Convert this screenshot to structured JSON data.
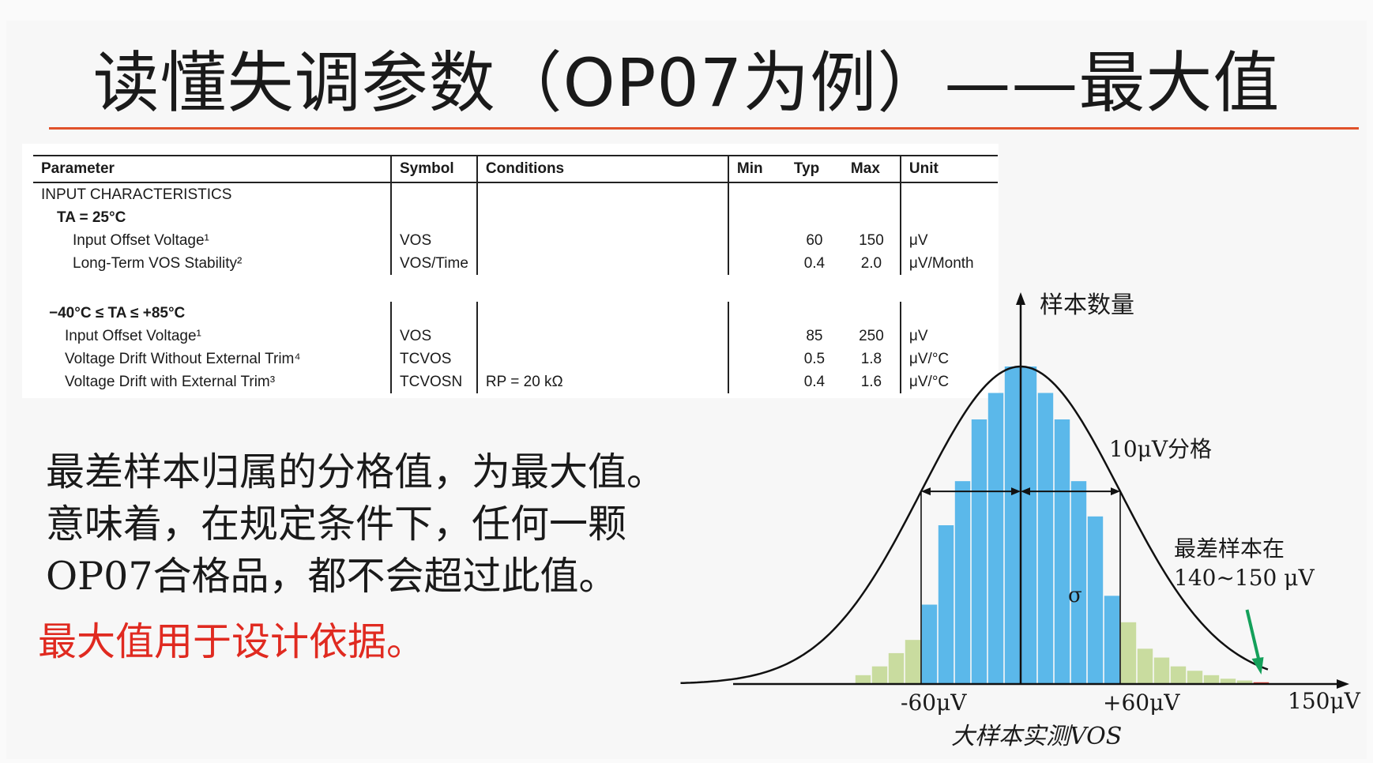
{
  "title": "读懂失调参数（OP07为例）——最大值",
  "spec_table": {
    "headers": [
      "Parameter",
      "Symbol",
      "Conditions",
      "Min",
      "Typ",
      "Max",
      "Unit"
    ],
    "section1": {
      "heading": "INPUT CHARACTERISTICS",
      "condition": "TA = 25°C",
      "rows": [
        {
          "parameter": "Input Offset Voltage¹",
          "symbol": "VOS",
          "conditions": "",
          "min": "",
          "typ": "60",
          "max": "150",
          "unit": "μV"
        },
        {
          "parameter": "Long-Term VOS Stability²",
          "symbol": "VOS/Time",
          "conditions": "",
          "min": "",
          "typ": "0.4",
          "max": "2.0",
          "unit": "μV/Month"
        }
      ]
    },
    "section2": {
      "condition": "−40°C ≤ TA ≤ +85°C",
      "rows": [
        {
          "parameter": "Input Offset Voltage¹",
          "symbol": "VOS",
          "conditions": "",
          "min": "",
          "typ": "85",
          "max": "250",
          "unit": "μV"
        },
        {
          "parameter": "Voltage Drift Without External Trim⁴",
          "symbol": "TCVOS",
          "conditions": "",
          "min": "",
          "typ": "0.5",
          "max": "1.8",
          "unit": "μV/°C"
        },
        {
          "parameter": "Voltage Drift with External Trim³",
          "symbol": "TCVOSN",
          "conditions": "RP = 20 kΩ",
          "min": "",
          "typ": "0.4",
          "max": "1.6",
          "unit": "μV/°C"
        }
      ]
    }
  },
  "paragraph": [
    "最差样本归属的分格值，为最大值。",
    "意味着，在规定条件下，任何一颗",
    "OP07合格品，都不会超过此值。"
  ],
  "highlight": "最大值用于设计依据。",
  "chart_data": {
    "type": "bar",
    "y_axis_label": "样本数量",
    "x_axis_label": "大样本实测VOS",
    "bin_width_label": "10μV分格",
    "sigma_label": "σ",
    "worst_sample_annotation": [
      "最差样本在",
      "140~150 μV"
    ],
    "tick_labels": [
      "-60μV",
      "+60μV",
      "150μV"
    ],
    "bin_centers": [
      -95,
      -85,
      -75,
      -65,
      -55,
      -45,
      -35,
      -25,
      -15,
      -5,
      5,
      15,
      25,
      35,
      45,
      55,
      65,
      75,
      85,
      95,
      105,
      115,
      125,
      135,
      145
    ],
    "counts": [
      1,
      2,
      3.5,
      5,
      9,
      18,
      23,
      30,
      33,
      36,
      36,
      33,
      30,
      23,
      19,
      10,
      7,
      4,
      3,
      2,
      1.5,
      1,
      0.6,
      0.4,
      0.2
    ],
    "inside_sigma_color": "#5bb8ea",
    "outside_sigma_color": "#c9dc9f",
    "worst_bin_color": "#e0453a",
    "arrow_color": "#14a05a",
    "curve_color": "#111111"
  }
}
